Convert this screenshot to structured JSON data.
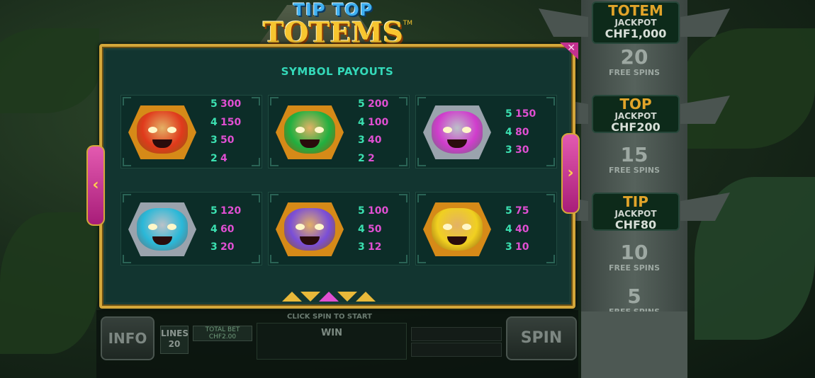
{
  "logo": {
    "line1": "TIP TOP",
    "line2": "TOTEMS",
    "tm": "TM"
  },
  "panel": {
    "title": "SYMBOL PAYOUTS",
    "close_symbol": "✕",
    "prev_symbol": "‹",
    "next_symbol": "›"
  },
  "symbols": [
    {
      "name": "red-fox-mask",
      "colors": {
        "frame": "#d68a18",
        "face": "#e03a1c"
      },
      "payouts": [
        {
          "count": "5",
          "amount": "300"
        },
        {
          "count": "4",
          "amount": "150"
        },
        {
          "count": "3",
          "amount": "50"
        },
        {
          "count": "2",
          "amount": "4"
        }
      ]
    },
    {
      "name": "green-bird-mask",
      "colors": {
        "frame": "#d68a18",
        "face": "#21b040"
      },
      "payouts": [
        {
          "count": "5",
          "amount": "200"
        },
        {
          "count": "4",
          "amount": "100"
        },
        {
          "count": "3",
          "amount": "40"
        },
        {
          "count": "2",
          "amount": "2"
        }
      ]
    },
    {
      "name": "pink-grin-mask",
      "colors": {
        "frame": "#9aa3ad",
        "face": "#d03ccc"
      },
      "payouts": [
        {
          "count": "5",
          "amount": "150"
        },
        {
          "count": "4",
          "amount": "80"
        },
        {
          "count": "3",
          "amount": "30"
        }
      ]
    },
    {
      "name": "blue-jaguar-mask",
      "colors": {
        "frame": "#9aa3ad",
        "face": "#2ab8d8"
      },
      "payouts": [
        {
          "count": "5",
          "amount": "120"
        },
        {
          "count": "4",
          "amount": "60"
        },
        {
          "count": "3",
          "amount": "20"
        }
      ]
    },
    {
      "name": "purple-block-mask",
      "colors": {
        "frame": "#d68a18",
        "face": "#7a4ed8"
      },
      "payouts": [
        {
          "count": "5",
          "amount": "100"
        },
        {
          "count": "4",
          "amount": "50"
        },
        {
          "count": "3",
          "amount": "12"
        }
      ]
    },
    {
      "name": "yellow-monkey-mask",
      "colors": {
        "frame": "#d68a18",
        "face": "#f0d020"
      },
      "payouts": [
        {
          "count": "5",
          "amount": "75"
        },
        {
          "count": "4",
          "amount": "40"
        },
        {
          "count": "3",
          "amount": "10"
        }
      ]
    }
  ],
  "totem": {
    "jackpot_main": {
      "title": "TOTEM",
      "sub": "JACKPOT",
      "value": "CHF1,000"
    },
    "fs20": {
      "num": "20",
      "label": "FREE SPINS"
    },
    "jackpot_top": {
      "title": "TOP",
      "sub": "JACKPOT",
      "value": "CHF200"
    },
    "fs15": {
      "num": "15",
      "label": "FREE SPINS"
    },
    "jackpot_tip": {
      "title": "TIP",
      "sub": "JACKPOT",
      "value": "CHF80"
    },
    "fs10": {
      "num": "10",
      "label": "FREE SPINS"
    },
    "fs5": {
      "num": "5",
      "label": "FREE SPINS"
    }
  },
  "bottom": {
    "info": "INFO",
    "lines_label": "LINES",
    "lines_value": "20",
    "total_bet_label": "TOTAL BET",
    "total_bet_value": "CHF2.00",
    "click_spin": "CLICK SPIN TO START",
    "win_label": "WIN",
    "spin": "SPIN"
  },
  "pager": {
    "pages": 5,
    "active_index": 2
  }
}
